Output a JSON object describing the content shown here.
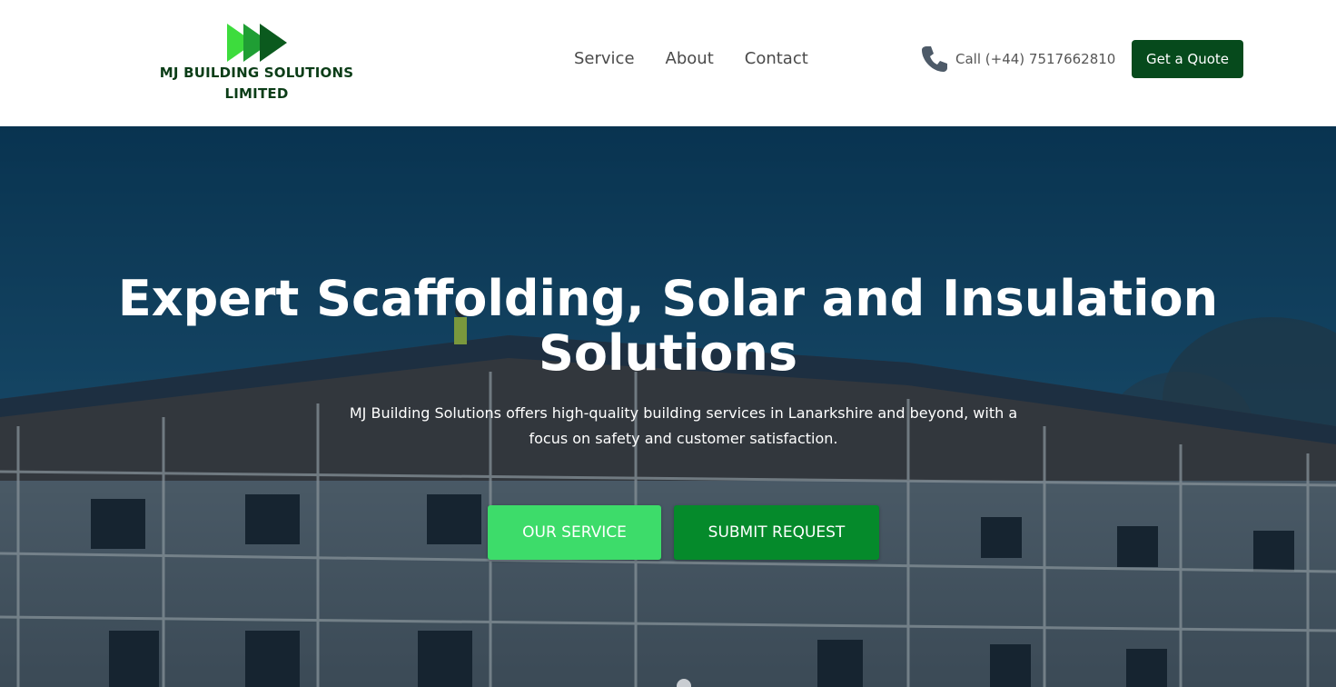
{
  "brand": {
    "line1": "MJ BUILDING SOLUTIONS",
    "line2": "LIMITED",
    "colors": {
      "dark_green": "#0b3d17",
      "bright_green": "#3ddc3d",
      "mid_green": "#1a8a2e"
    }
  },
  "nav": {
    "items": [
      {
        "label": "Service"
      },
      {
        "label": "About"
      },
      {
        "label": "Contact"
      }
    ]
  },
  "contact": {
    "phone_icon": "phone-icon",
    "phone_label": "Call (+44) 7517662810"
  },
  "header_cta": {
    "label": "Get a Quote",
    "color": "#064a1c"
  },
  "hero": {
    "title": "Expert Scaffolding, Solar and Insulation Solutions",
    "subtitle": "MJ Building Solutions offers high-quality building services in Lanarkshire and beyond, with a focus on safety and customer satisfaction.",
    "primary_button": {
      "label": "OUR SERVICE",
      "color": "#3ddc6a"
    },
    "secondary_button": {
      "label": "SUBMIT REQUEST",
      "color": "#058a2b"
    }
  }
}
